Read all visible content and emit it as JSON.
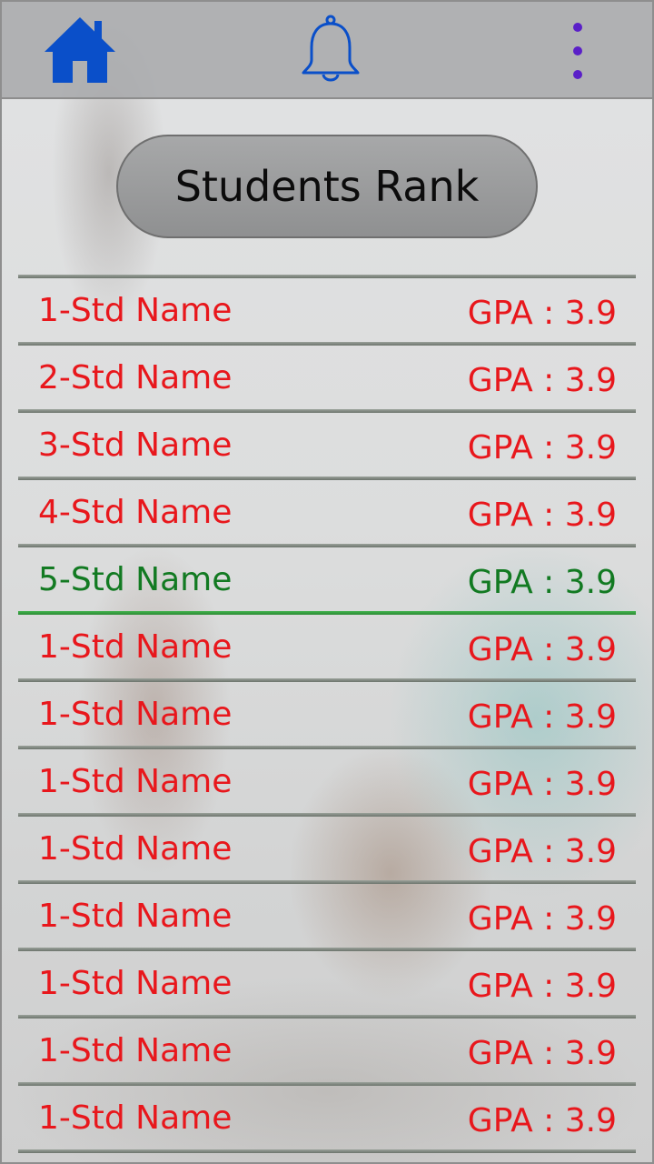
{
  "topbar": {
    "home_icon": "home-icon",
    "bell_icon": "bell-icon",
    "menu_icon": "more-vertical-icon",
    "colors": {
      "icon_blue": "#0a4fc9",
      "menu_dots": "#5a1fc8"
    }
  },
  "title": "Students Rank",
  "colors": {
    "default_row": "#e8171c",
    "highlight_row": "#127a22"
  },
  "students": [
    {
      "name": "1-Std Name",
      "gpa": "GPA : 3.9",
      "highlight": false
    },
    {
      "name": "2-Std Name",
      "gpa": "GPA : 3.9",
      "highlight": false
    },
    {
      "name": "3-Std Name",
      "gpa": "GPA : 3.9",
      "highlight": false
    },
    {
      "name": "4-Std Name",
      "gpa": "GPA : 3.9",
      "highlight": false
    },
    {
      "name": "5-Std Name",
      "gpa": "GPA : 3.9",
      "highlight": true
    },
    {
      "name": "1-Std Name",
      "gpa": "GPA : 3.9",
      "highlight": false
    },
    {
      "name": "1-Std Name",
      "gpa": "GPA : 3.9",
      "highlight": false
    },
    {
      "name": "1-Std Name",
      "gpa": "GPA : 3.9",
      "highlight": false
    },
    {
      "name": "1-Std Name",
      "gpa": "GPA : 3.9",
      "highlight": false
    },
    {
      "name": "1-Std Name",
      "gpa": "GPA : 3.9",
      "highlight": false
    },
    {
      "name": "1-Std Name",
      "gpa": "GPA : 3.9",
      "highlight": false
    },
    {
      "name": "1-Std Name",
      "gpa": "GPA : 3.9",
      "highlight": false
    },
    {
      "name": "1-Std Name",
      "gpa": "GPA : 3.9",
      "highlight": false
    }
  ]
}
